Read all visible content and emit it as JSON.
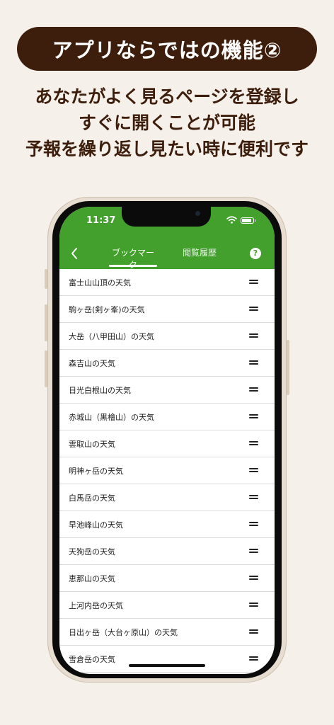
{
  "banner": {
    "title": "アプリならではの機能②"
  },
  "caption": {
    "lines": [
      "あなたがよく見るページを登録し",
      "すぐに開くことが可能",
      "予報を繰り返し見たい時に便利です"
    ]
  },
  "status_bar": {
    "time": "11:37"
  },
  "nav": {
    "back_icon": "chevron-left-icon",
    "tabs": [
      {
        "label": "ブックマーク",
        "active": true
      },
      {
        "label": "閲覧履歴",
        "active": false
      }
    ],
    "help_label": "?"
  },
  "bookmarks": [
    "富士山山頂の天気",
    "駒ヶ岳(剣ヶ峯)の天気",
    "大岳（八甲田山）の天気",
    "森吉山の天気",
    "日光白根山の天気",
    "赤城山（黒檜山）の天気",
    "雲取山の天気",
    "明神ヶ岳の天気",
    "白馬岳の天気",
    "早池峰山の天気",
    "天狗岳の天気",
    "恵那山の天気",
    "上河内岳の天気",
    "日出ヶ岳（大台ヶ原山）の天気",
    "雪倉岳の天気"
  ],
  "colors": {
    "accent": "#43a02d",
    "banner": "#3d1e0c",
    "background": "#f5f0ea"
  }
}
